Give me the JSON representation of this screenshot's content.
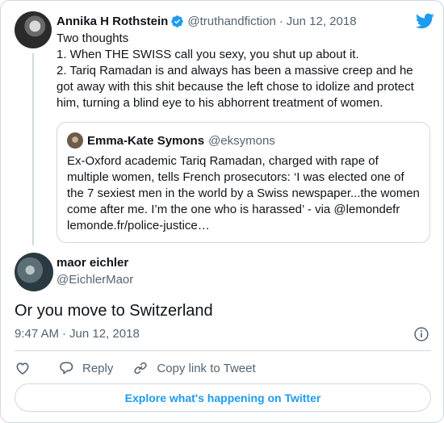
{
  "parent_tweet": {
    "author_name": "Annika H Rothstein",
    "handle": "@truthandfiction",
    "separator": "·",
    "date": "Jun 12, 2018",
    "text_lines": [
      "Two thoughts",
      "1. When THE SWISS call you sexy, you shut up about it.",
      "2. Tariq Ramadan is and always has been a massive creep and he",
      "got away with this shit because the left chose to idolize and protect",
      "him, turning a blind eye to his abhorrent treatment of women."
    ],
    "quoted_tweet": {
      "author_name": "Emma-Kate Symons",
      "handle": "@eksymons",
      "text_lines": [
        "Ex-Oxford academic Tariq Ramadan, charged with rape of",
        "multiple women,  tells French prosecutors: ‘I was elected one of",
        "the 7 sexiest men in the world by a Swiss newspaper...the women",
        "come after me. I’m the one who is harassed’ - via @lemondefr",
        "lemonde.fr/police-justice…"
      ]
    }
  },
  "main_tweet": {
    "author_name": "maor eichler",
    "handle": "@EichlerMaor",
    "text": "Or you move to Switzerland",
    "time": "9:47 AM",
    "separator": "·",
    "date": "Jun 12, 2018"
  },
  "actions": {
    "reply_label": "Reply",
    "copy_link_label": "Copy link to Tweet"
  },
  "explore_label": "Explore what's happening on Twitter",
  "icons": {
    "brand": "twitter-bird-icon",
    "verified": "verified-badge-icon",
    "info": "info-icon",
    "like": "heart-icon",
    "reply": "speech-bubble-icon",
    "copy_link": "link-icon"
  },
  "colors": {
    "brand_blue": "#1d9bf0",
    "text": "#0f1419",
    "muted": "#536471",
    "border": "#cfd9de"
  }
}
